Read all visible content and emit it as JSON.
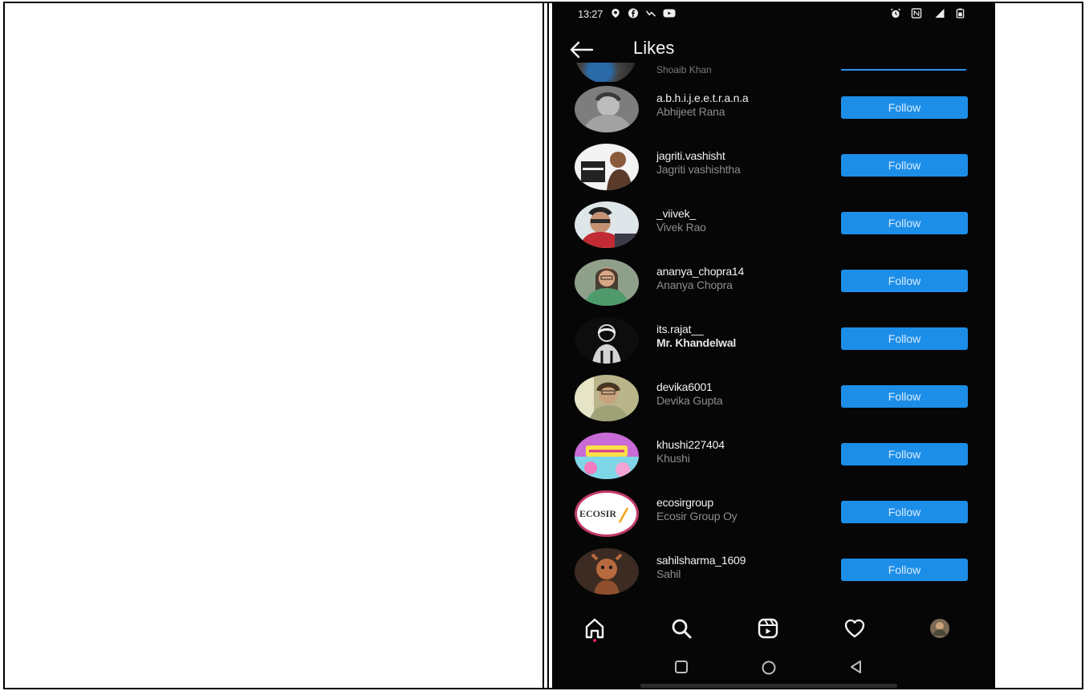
{
  "status_bar": {
    "time": "13:27",
    "left_icons": [
      "location-icon",
      "facebook-icon",
      "missed-call-icon",
      "youtube-icon"
    ],
    "right_icons": [
      "alarm-icon",
      "nfc-icon",
      "signal-icon",
      "battery-icon"
    ]
  },
  "header": {
    "title": "Likes"
  },
  "partial_row": {
    "fullname": "Shoaib Khan"
  },
  "likes": [
    {
      "username": "a.b.h.i.j.e.e.t.r.a.n.a",
      "fullname": "Abhijeet Rana",
      "button": "Follow",
      "bold": false
    },
    {
      "username": "jagriti.vashisht",
      "fullname": "Jagriti vashishtha",
      "button": "Follow",
      "bold": false
    },
    {
      "username": "_viivek_",
      "fullname": "Vivek Rao",
      "button": "Follow",
      "bold": false
    },
    {
      "username": "ananya_chopra14",
      "fullname": "Ananya Chopra",
      "button": "Follow",
      "bold": false
    },
    {
      "username": "its.rajat__",
      "fullname": "Mr. Khandelwal",
      "button": "Follow",
      "bold": true
    },
    {
      "username": "devika6001",
      "fullname": "Devika Gupta",
      "button": "Follow",
      "bold": false
    },
    {
      "username": "khushi227404",
      "fullname": "Khushi",
      "button": "Follow",
      "bold": false
    },
    {
      "username": "ecosirgroup",
      "fullname": "Ecosir Group Oy",
      "button": "Follow",
      "bold": false
    },
    {
      "username": "sahilsharma_1609",
      "fullname": "Sahil",
      "button": "Follow",
      "bold": false
    }
  ],
  "ecosir_logo_text": "ECOSIR",
  "bottom_nav": [
    "home-icon",
    "search-icon",
    "reels-icon",
    "heart-icon",
    "profile-avatar"
  ],
  "system_nav": [
    "recents-button",
    "home-button",
    "back-button"
  ],
  "colors": {
    "background": "#060606",
    "follow_button": "#1d8ee8",
    "text_secondary": "#8c8c8c"
  }
}
